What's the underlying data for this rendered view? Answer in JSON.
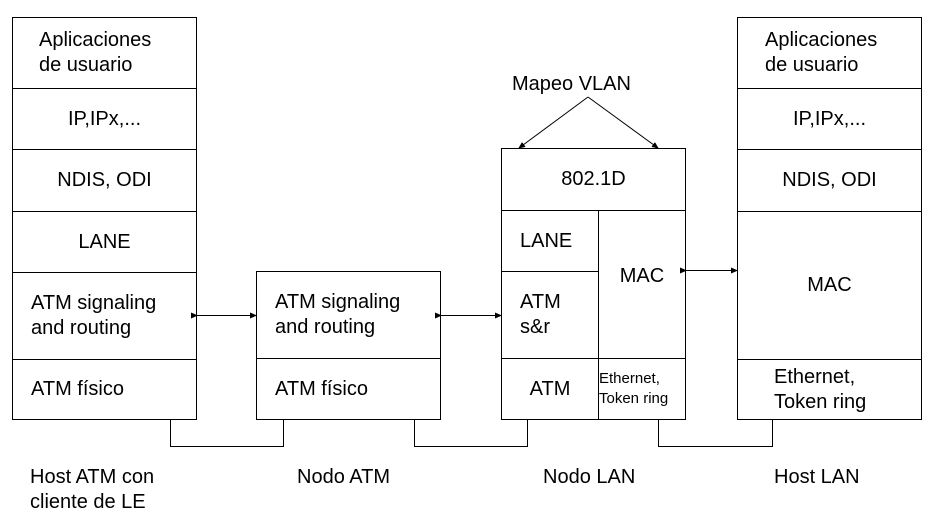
{
  "stacks": {
    "host_atm": {
      "layers": [
        "Aplicaciones\nde usuario",
        "IP,IPx,...",
        "NDIS, ODI",
        "LANE",
        "ATM signaling\nand routing",
        "ATM físico"
      ],
      "caption": "Host ATM con\ncliente de LE"
    },
    "nodo_atm": {
      "layers": [
        "ATM signaling\nand routing",
        "ATM físico"
      ],
      "caption": "Nodo ATM"
    },
    "nodo_lan": {
      "top": "802.1D",
      "left_layers": [
        "LANE",
        "ATM\ns&r",
        "ATM"
      ],
      "right_layers": [
        "MAC",
        "Ethernet,\nToken ring"
      ],
      "caption": "Nodo LAN"
    },
    "host_lan": {
      "layers": [
        "Aplicaciones\nde usuario",
        "IP,IPx,...",
        "NDIS, ODI",
        "MAC",
        "Ethernet,\nToken ring"
      ],
      "caption": "Host LAN"
    }
  },
  "annotation": "Mapeo VLAN"
}
